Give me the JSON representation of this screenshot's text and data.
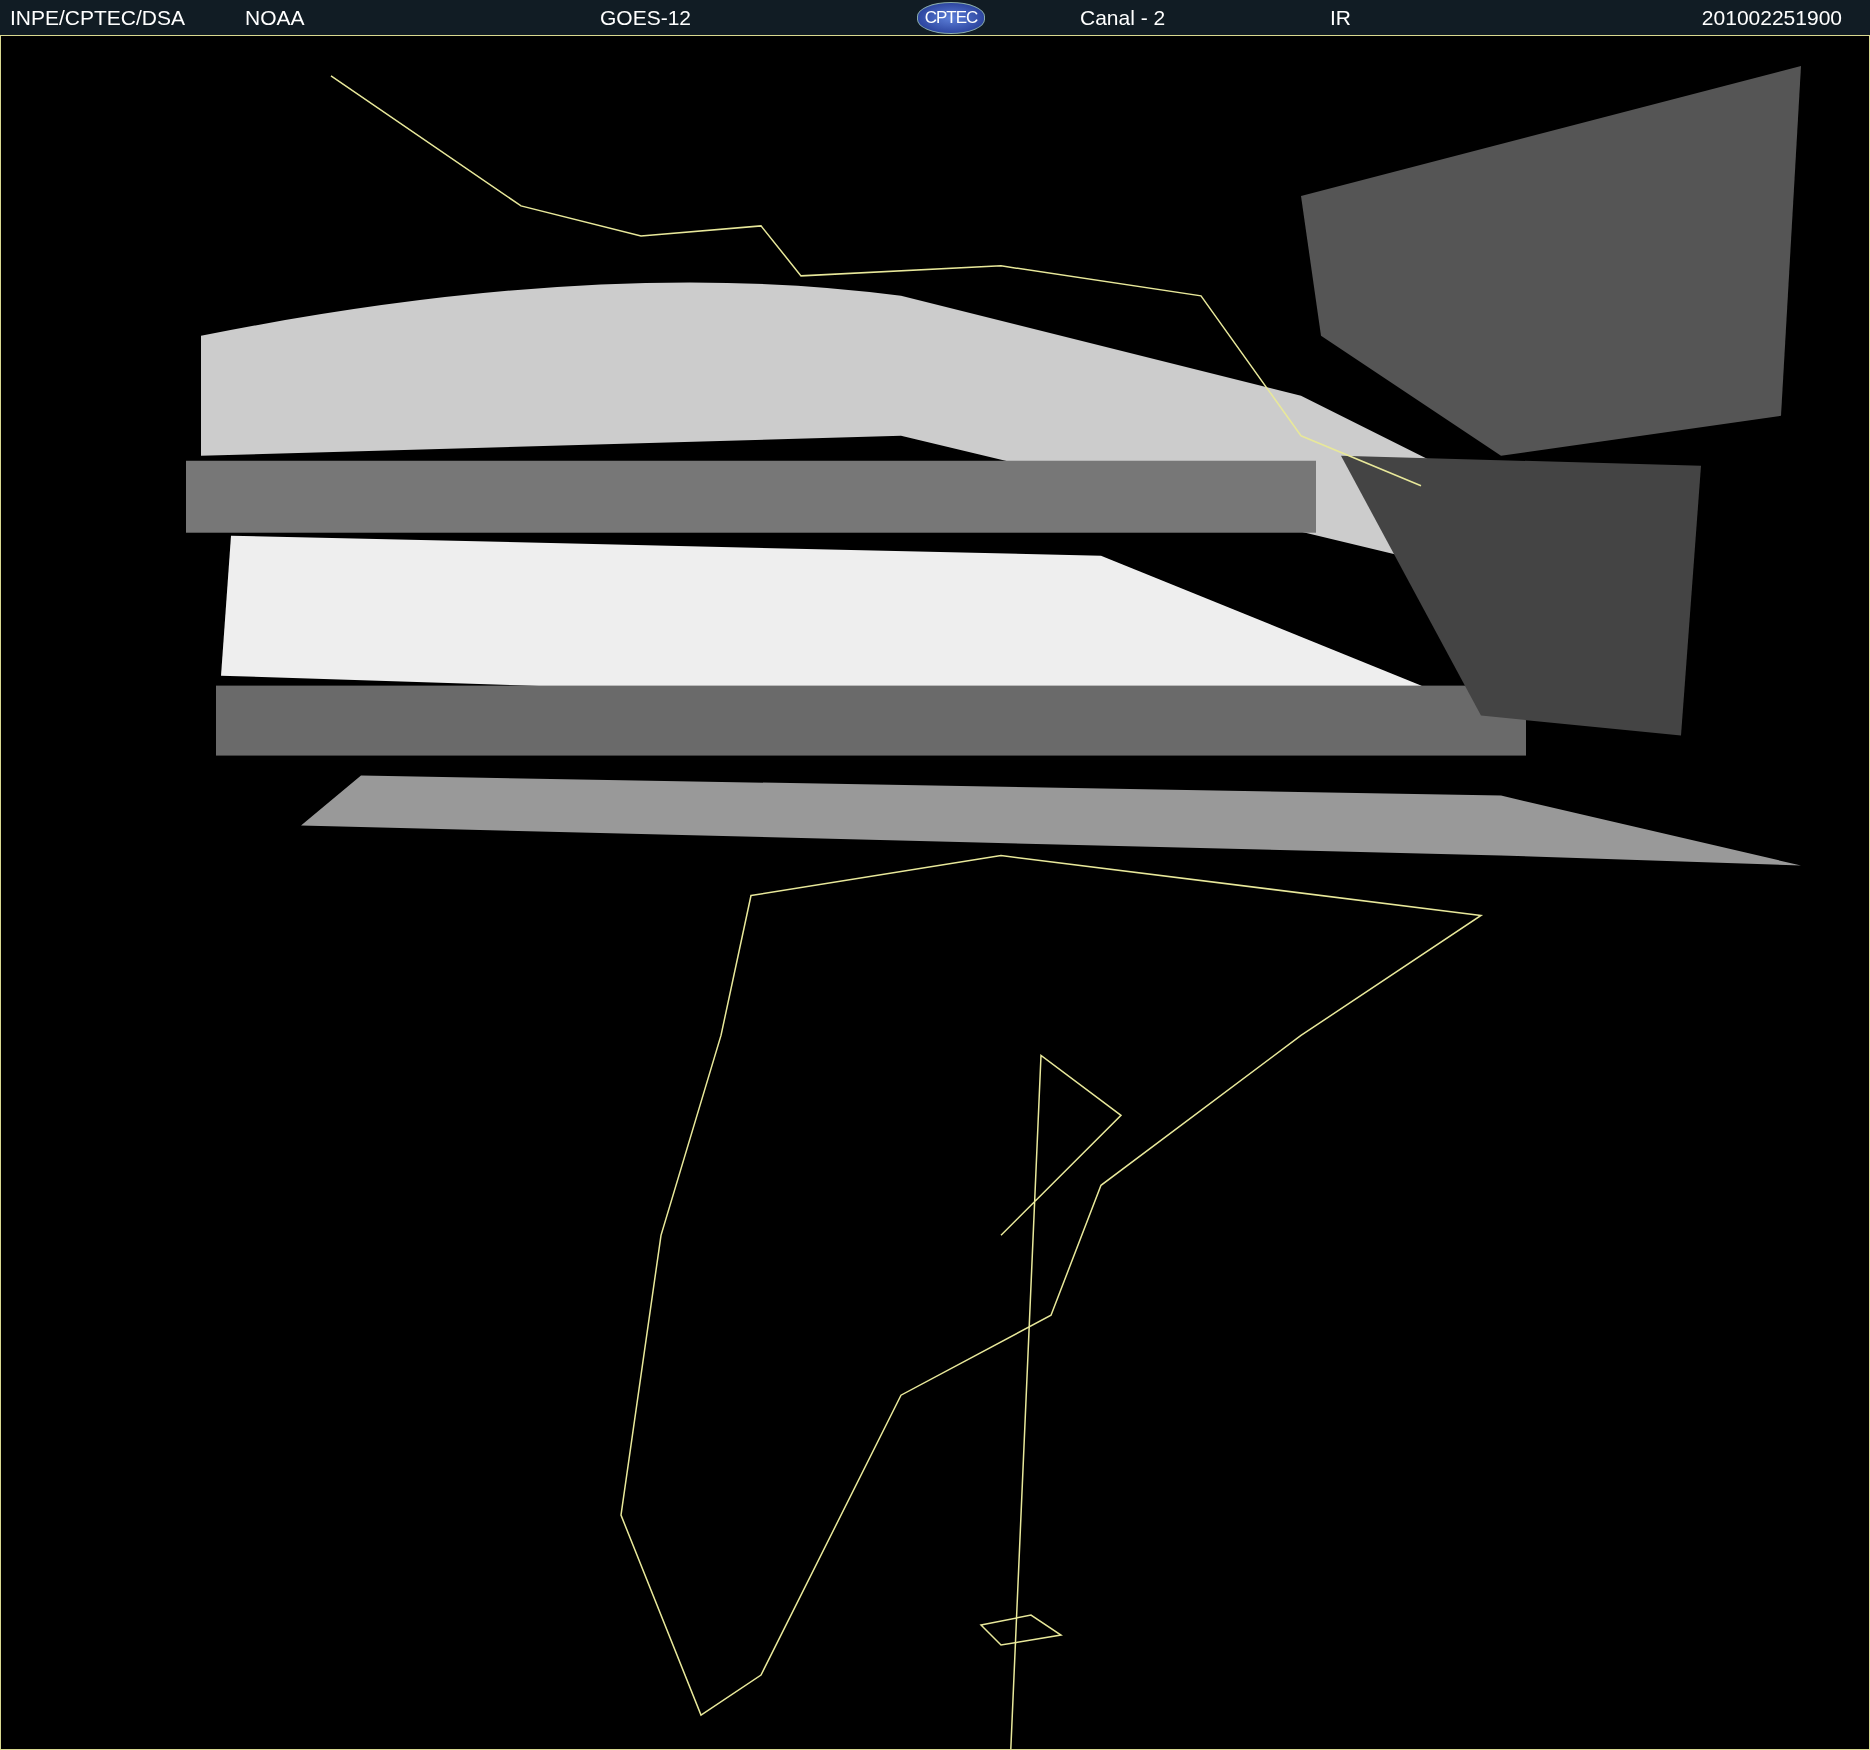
{
  "header": {
    "source": "INPE/CPTEC/DSA",
    "agency": "NOAA",
    "satellite": "GOES-12",
    "logo": "CPTEC",
    "channel": "Canal - 2",
    "band": "IR",
    "timestamp": "201002251900"
  }
}
